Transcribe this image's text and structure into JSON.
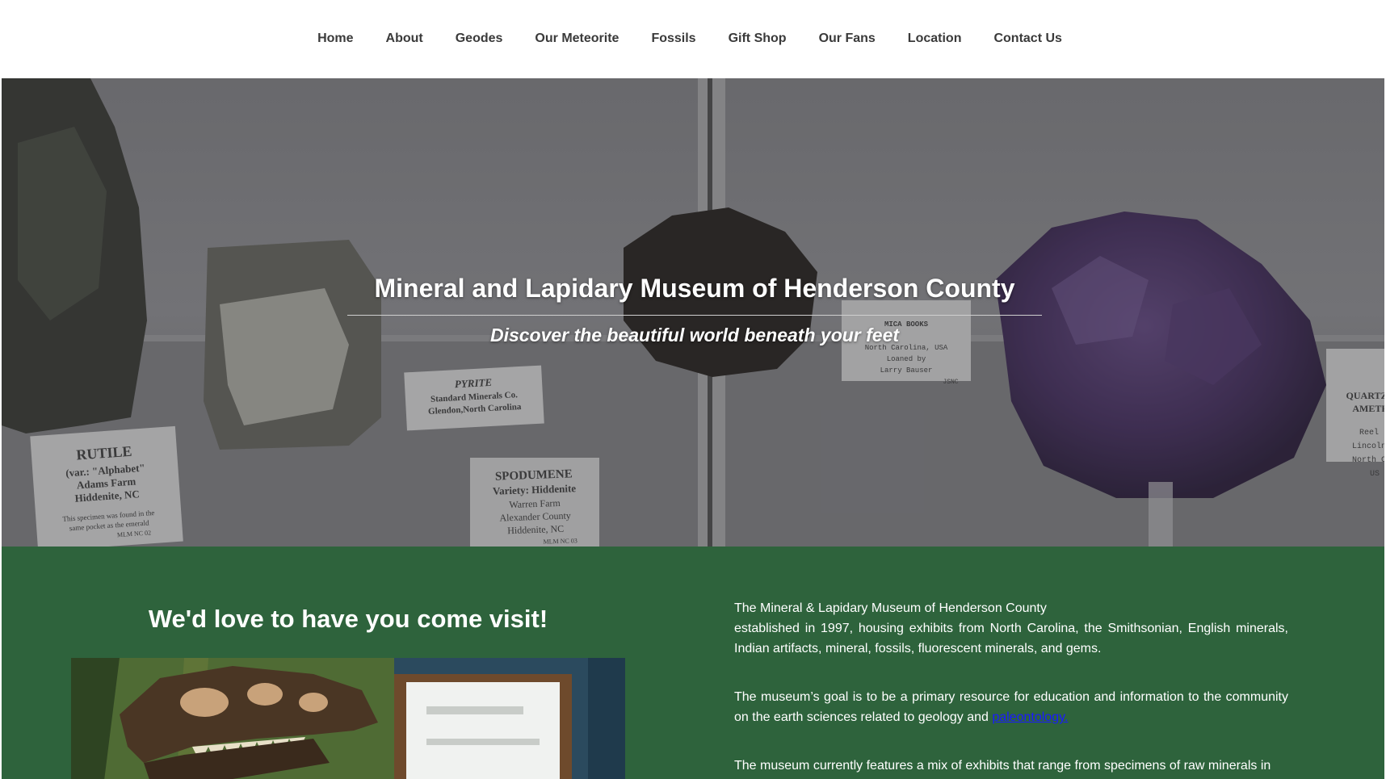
{
  "nav": {
    "items": [
      {
        "label": "Home"
      },
      {
        "label": "About"
      },
      {
        "label": "Geodes"
      },
      {
        "label": "Our Meteorite"
      },
      {
        "label": "Fossils"
      },
      {
        "label": "Gift Shop"
      },
      {
        "label": "Our Fans"
      },
      {
        "label": "Location"
      },
      {
        "label": "Contact Us"
      }
    ]
  },
  "hero": {
    "title": "Mineral and Lapidary Museum of Henderson County",
    "subtitle": "Discover the beautiful world beneath your feet",
    "labels": {
      "rutile": [
        "RUTILE",
        "(var.: \"Alphabet\"",
        "Adams Farm",
        "Hiddenite, NC",
        "This specimen was found in the",
        "same pocket as the emerald",
        "MLM NC 02"
      ],
      "pyrite": [
        "PYRITE",
        "Standard Minerals Co.",
        "Glendon,North Carolina"
      ],
      "spodumene": [
        "SPODUMENE",
        "Variety: Hiddenite",
        "Warren Farm",
        "Alexander County",
        "Hiddenite, NC",
        "MLM NC 03"
      ],
      "mica": [
        "MICA BOOKS",
        "North Carolina, USA",
        "Loaned by",
        "Larry Bauser",
        "JSNC"
      ],
      "quartz": [
        "QUARTZ",
        "AMETH",
        "Reel",
        "Lincoln",
        "North C",
        "US"
      ]
    }
  },
  "visit": {
    "heading": "We'd love to have you come visit!"
  },
  "about": {
    "p1_line1": "The Mineral & Lapidary Museum of Henderson County",
    "p1_line2": "established in 1997, housing exhibits from North Carolina, the Smithsonian, English minerals, Indian artifacts, mineral, fossils, fluorescent minerals, and gems.",
    "p2_text": "The museum’s goal is to be a primary resource for education and information to the community on the earth sciences related to geology and ",
    "p2_link": "paleontology.",
    "p3_text": "The museum currently features a mix of exhibits that range from specimens of raw minerals in"
  },
  "colors": {
    "green_section": "#2e633c",
    "nav_text": "#3a3a3a",
    "link": "#1a1aff",
    "amethyst": "#4b3466"
  }
}
